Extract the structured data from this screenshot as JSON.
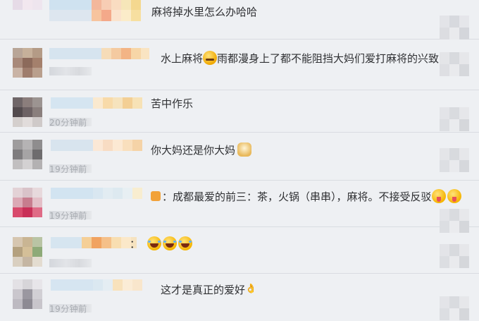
{
  "comments": [
    {
      "text": "麻将掉水里怎么办哈哈",
      "time": ""
    },
    {
      "text_before": "水上麻将",
      "text_after": "雨都漫身上了都不能阻挡大妈们爱打麻将的兴致",
      "time": ""
    },
    {
      "text": "苦中作乐",
      "time": "20分钟前"
    },
    {
      "text": "你大妈还是你大妈",
      "time": "19分钟前"
    },
    {
      "text": "：成都最爱的前三：茶，火锅（串串），麻将。不接受反驳",
      "time": "19分钟前"
    },
    {
      "text": "：",
      "time": ""
    },
    {
      "text": "这才是真正的爱好",
      "time": "19分钟前"
    }
  ],
  "colors": {
    "background": "#eef0f3",
    "divider": "#d9dce1",
    "text": "#2f3033",
    "timestamp": "#9fa3a9"
  },
  "icons": [
    "avatar-mosaic",
    "sweat-smile-icon",
    "doge-icon",
    "fire-icon",
    "tongue-out-icon",
    "laugh-cry-icon",
    "ok-hand-icon"
  ]
}
